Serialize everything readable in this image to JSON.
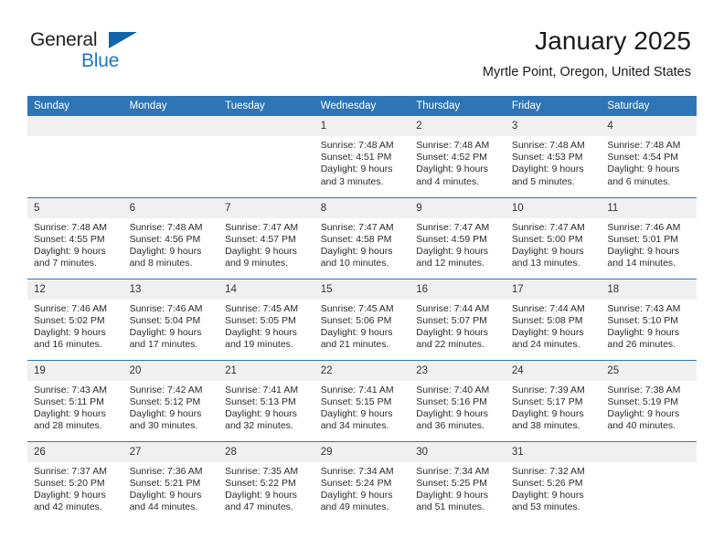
{
  "brand": {
    "name_top": "General",
    "name_bottom": "Blue",
    "mark": "triangle-logo",
    "color_dark": "#231f20",
    "color_blue": "#1f78c1"
  },
  "header": {
    "title": "January 2025",
    "subtitle": "Myrtle Point, Oregon, United States"
  },
  "theme": {
    "header_bg": "#2e75b6",
    "header_text": "#ffffff",
    "daynum_bg": "#f0f0f0",
    "cell_bg": "#ffffff",
    "grid_line": "#2e75b6"
  },
  "calendar": {
    "weekdays": [
      "Sunday",
      "Monday",
      "Tuesday",
      "Wednesday",
      "Thursday",
      "Friday",
      "Saturday"
    ],
    "weeks": [
      [
        {
          "day": "",
          "empty": true,
          "sunrise": "",
          "sunset": "",
          "daylight1": "",
          "daylight2": ""
        },
        {
          "day": "",
          "empty": true,
          "sunrise": "",
          "sunset": "",
          "daylight1": "",
          "daylight2": ""
        },
        {
          "day": "",
          "empty": true,
          "sunrise": "",
          "sunset": "",
          "daylight1": "",
          "daylight2": ""
        },
        {
          "day": "1",
          "empty": false,
          "sunrise": "Sunrise: 7:48 AM",
          "sunset": "Sunset: 4:51 PM",
          "daylight1": "Daylight: 9 hours",
          "daylight2": "and 3 minutes."
        },
        {
          "day": "2",
          "empty": false,
          "sunrise": "Sunrise: 7:48 AM",
          "sunset": "Sunset: 4:52 PM",
          "daylight1": "Daylight: 9 hours",
          "daylight2": "and 4 minutes."
        },
        {
          "day": "3",
          "empty": false,
          "sunrise": "Sunrise: 7:48 AM",
          "sunset": "Sunset: 4:53 PM",
          "daylight1": "Daylight: 9 hours",
          "daylight2": "and 5 minutes."
        },
        {
          "day": "4",
          "empty": false,
          "sunrise": "Sunrise: 7:48 AM",
          "sunset": "Sunset: 4:54 PM",
          "daylight1": "Daylight: 9 hours",
          "daylight2": "and 6 minutes."
        }
      ],
      [
        {
          "day": "5",
          "empty": false,
          "sunrise": "Sunrise: 7:48 AM",
          "sunset": "Sunset: 4:55 PM",
          "daylight1": "Daylight: 9 hours",
          "daylight2": "and 7 minutes."
        },
        {
          "day": "6",
          "empty": false,
          "sunrise": "Sunrise: 7:48 AM",
          "sunset": "Sunset: 4:56 PM",
          "daylight1": "Daylight: 9 hours",
          "daylight2": "and 8 minutes."
        },
        {
          "day": "7",
          "empty": false,
          "sunrise": "Sunrise: 7:47 AM",
          "sunset": "Sunset: 4:57 PM",
          "daylight1": "Daylight: 9 hours",
          "daylight2": "and 9 minutes."
        },
        {
          "day": "8",
          "empty": false,
          "sunrise": "Sunrise: 7:47 AM",
          "sunset": "Sunset: 4:58 PM",
          "daylight1": "Daylight: 9 hours",
          "daylight2": "and 10 minutes."
        },
        {
          "day": "9",
          "empty": false,
          "sunrise": "Sunrise: 7:47 AM",
          "sunset": "Sunset: 4:59 PM",
          "daylight1": "Daylight: 9 hours",
          "daylight2": "and 12 minutes."
        },
        {
          "day": "10",
          "empty": false,
          "sunrise": "Sunrise: 7:47 AM",
          "sunset": "Sunset: 5:00 PM",
          "daylight1": "Daylight: 9 hours",
          "daylight2": "and 13 minutes."
        },
        {
          "day": "11",
          "empty": false,
          "sunrise": "Sunrise: 7:46 AM",
          "sunset": "Sunset: 5:01 PM",
          "daylight1": "Daylight: 9 hours",
          "daylight2": "and 14 minutes."
        }
      ],
      [
        {
          "day": "12",
          "empty": false,
          "sunrise": "Sunrise: 7:46 AM",
          "sunset": "Sunset: 5:02 PM",
          "daylight1": "Daylight: 9 hours",
          "daylight2": "and 16 minutes."
        },
        {
          "day": "13",
          "empty": false,
          "sunrise": "Sunrise: 7:46 AM",
          "sunset": "Sunset: 5:04 PM",
          "daylight1": "Daylight: 9 hours",
          "daylight2": "and 17 minutes."
        },
        {
          "day": "14",
          "empty": false,
          "sunrise": "Sunrise: 7:45 AM",
          "sunset": "Sunset: 5:05 PM",
          "daylight1": "Daylight: 9 hours",
          "daylight2": "and 19 minutes."
        },
        {
          "day": "15",
          "empty": false,
          "sunrise": "Sunrise: 7:45 AM",
          "sunset": "Sunset: 5:06 PM",
          "daylight1": "Daylight: 9 hours",
          "daylight2": "and 21 minutes."
        },
        {
          "day": "16",
          "empty": false,
          "sunrise": "Sunrise: 7:44 AM",
          "sunset": "Sunset: 5:07 PM",
          "daylight1": "Daylight: 9 hours",
          "daylight2": "and 22 minutes."
        },
        {
          "day": "17",
          "empty": false,
          "sunrise": "Sunrise: 7:44 AM",
          "sunset": "Sunset: 5:08 PM",
          "daylight1": "Daylight: 9 hours",
          "daylight2": "and 24 minutes."
        },
        {
          "day": "18",
          "empty": false,
          "sunrise": "Sunrise: 7:43 AM",
          "sunset": "Sunset: 5:10 PM",
          "daylight1": "Daylight: 9 hours",
          "daylight2": "and 26 minutes."
        }
      ],
      [
        {
          "day": "19",
          "empty": false,
          "sunrise": "Sunrise: 7:43 AM",
          "sunset": "Sunset: 5:11 PM",
          "daylight1": "Daylight: 9 hours",
          "daylight2": "and 28 minutes."
        },
        {
          "day": "20",
          "empty": false,
          "sunrise": "Sunrise: 7:42 AM",
          "sunset": "Sunset: 5:12 PM",
          "daylight1": "Daylight: 9 hours",
          "daylight2": "and 30 minutes."
        },
        {
          "day": "21",
          "empty": false,
          "sunrise": "Sunrise: 7:41 AM",
          "sunset": "Sunset: 5:13 PM",
          "daylight1": "Daylight: 9 hours",
          "daylight2": "and 32 minutes."
        },
        {
          "day": "22",
          "empty": false,
          "sunrise": "Sunrise: 7:41 AM",
          "sunset": "Sunset: 5:15 PM",
          "daylight1": "Daylight: 9 hours",
          "daylight2": "and 34 minutes."
        },
        {
          "day": "23",
          "empty": false,
          "sunrise": "Sunrise: 7:40 AM",
          "sunset": "Sunset: 5:16 PM",
          "daylight1": "Daylight: 9 hours",
          "daylight2": "and 36 minutes."
        },
        {
          "day": "24",
          "empty": false,
          "sunrise": "Sunrise: 7:39 AM",
          "sunset": "Sunset: 5:17 PM",
          "daylight1": "Daylight: 9 hours",
          "daylight2": "and 38 minutes."
        },
        {
          "day": "25",
          "empty": false,
          "sunrise": "Sunrise: 7:38 AM",
          "sunset": "Sunset: 5:19 PM",
          "daylight1": "Daylight: 9 hours",
          "daylight2": "and 40 minutes."
        }
      ],
      [
        {
          "day": "26",
          "empty": false,
          "sunrise": "Sunrise: 7:37 AM",
          "sunset": "Sunset: 5:20 PM",
          "daylight1": "Daylight: 9 hours",
          "daylight2": "and 42 minutes."
        },
        {
          "day": "27",
          "empty": false,
          "sunrise": "Sunrise: 7:36 AM",
          "sunset": "Sunset: 5:21 PM",
          "daylight1": "Daylight: 9 hours",
          "daylight2": "and 44 minutes."
        },
        {
          "day": "28",
          "empty": false,
          "sunrise": "Sunrise: 7:35 AM",
          "sunset": "Sunset: 5:22 PM",
          "daylight1": "Daylight: 9 hours",
          "daylight2": "and 47 minutes."
        },
        {
          "day": "29",
          "empty": false,
          "sunrise": "Sunrise: 7:34 AM",
          "sunset": "Sunset: 5:24 PM",
          "daylight1": "Daylight: 9 hours",
          "daylight2": "and 49 minutes."
        },
        {
          "day": "30",
          "empty": false,
          "sunrise": "Sunrise: 7:34 AM",
          "sunset": "Sunset: 5:25 PM",
          "daylight1": "Daylight: 9 hours",
          "daylight2": "and 51 minutes."
        },
        {
          "day": "31",
          "empty": false,
          "sunrise": "Sunrise: 7:32 AM",
          "sunset": "Sunset: 5:26 PM",
          "daylight1": "Daylight: 9 hours",
          "daylight2": "and 53 minutes."
        },
        {
          "day": "",
          "empty": true,
          "sunrise": "",
          "sunset": "",
          "daylight1": "",
          "daylight2": ""
        }
      ]
    ]
  }
}
